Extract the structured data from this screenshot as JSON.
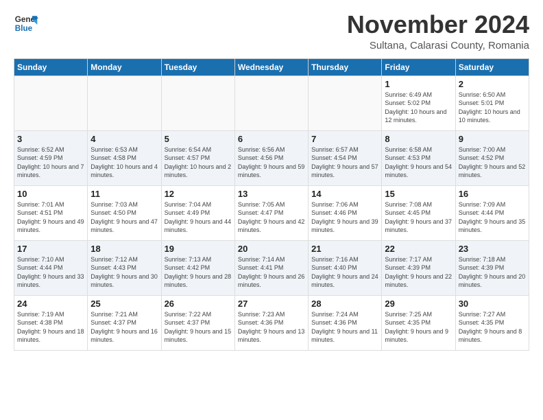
{
  "header": {
    "logo_line1": "General",
    "logo_line2": "Blue",
    "month_title": "November 2024",
    "location": "Sultana, Calarasi County, Romania"
  },
  "days_of_week": [
    "Sunday",
    "Monday",
    "Tuesday",
    "Wednesday",
    "Thursday",
    "Friday",
    "Saturday"
  ],
  "weeks": [
    [
      {
        "day": "",
        "info": ""
      },
      {
        "day": "",
        "info": ""
      },
      {
        "day": "",
        "info": ""
      },
      {
        "day": "",
        "info": ""
      },
      {
        "day": "",
        "info": ""
      },
      {
        "day": "1",
        "info": "Sunrise: 6:49 AM\nSunset: 5:02 PM\nDaylight: 10 hours and 12 minutes."
      },
      {
        "day": "2",
        "info": "Sunrise: 6:50 AM\nSunset: 5:01 PM\nDaylight: 10 hours and 10 minutes."
      }
    ],
    [
      {
        "day": "3",
        "info": "Sunrise: 6:52 AM\nSunset: 4:59 PM\nDaylight: 10 hours and 7 minutes."
      },
      {
        "day": "4",
        "info": "Sunrise: 6:53 AM\nSunset: 4:58 PM\nDaylight: 10 hours and 4 minutes."
      },
      {
        "day": "5",
        "info": "Sunrise: 6:54 AM\nSunset: 4:57 PM\nDaylight: 10 hours and 2 minutes."
      },
      {
        "day": "6",
        "info": "Sunrise: 6:56 AM\nSunset: 4:56 PM\nDaylight: 9 hours and 59 minutes."
      },
      {
        "day": "7",
        "info": "Sunrise: 6:57 AM\nSunset: 4:54 PM\nDaylight: 9 hours and 57 minutes."
      },
      {
        "day": "8",
        "info": "Sunrise: 6:58 AM\nSunset: 4:53 PM\nDaylight: 9 hours and 54 minutes."
      },
      {
        "day": "9",
        "info": "Sunrise: 7:00 AM\nSunset: 4:52 PM\nDaylight: 9 hours and 52 minutes."
      }
    ],
    [
      {
        "day": "10",
        "info": "Sunrise: 7:01 AM\nSunset: 4:51 PM\nDaylight: 9 hours and 49 minutes."
      },
      {
        "day": "11",
        "info": "Sunrise: 7:03 AM\nSunset: 4:50 PM\nDaylight: 9 hours and 47 minutes."
      },
      {
        "day": "12",
        "info": "Sunrise: 7:04 AM\nSunset: 4:49 PM\nDaylight: 9 hours and 44 minutes."
      },
      {
        "day": "13",
        "info": "Sunrise: 7:05 AM\nSunset: 4:47 PM\nDaylight: 9 hours and 42 minutes."
      },
      {
        "day": "14",
        "info": "Sunrise: 7:06 AM\nSunset: 4:46 PM\nDaylight: 9 hours and 39 minutes."
      },
      {
        "day": "15",
        "info": "Sunrise: 7:08 AM\nSunset: 4:45 PM\nDaylight: 9 hours and 37 minutes."
      },
      {
        "day": "16",
        "info": "Sunrise: 7:09 AM\nSunset: 4:44 PM\nDaylight: 9 hours and 35 minutes."
      }
    ],
    [
      {
        "day": "17",
        "info": "Sunrise: 7:10 AM\nSunset: 4:44 PM\nDaylight: 9 hours and 33 minutes."
      },
      {
        "day": "18",
        "info": "Sunrise: 7:12 AM\nSunset: 4:43 PM\nDaylight: 9 hours and 30 minutes."
      },
      {
        "day": "19",
        "info": "Sunrise: 7:13 AM\nSunset: 4:42 PM\nDaylight: 9 hours and 28 minutes."
      },
      {
        "day": "20",
        "info": "Sunrise: 7:14 AM\nSunset: 4:41 PM\nDaylight: 9 hours and 26 minutes."
      },
      {
        "day": "21",
        "info": "Sunrise: 7:16 AM\nSunset: 4:40 PM\nDaylight: 9 hours and 24 minutes."
      },
      {
        "day": "22",
        "info": "Sunrise: 7:17 AM\nSunset: 4:39 PM\nDaylight: 9 hours and 22 minutes."
      },
      {
        "day": "23",
        "info": "Sunrise: 7:18 AM\nSunset: 4:39 PM\nDaylight: 9 hours and 20 minutes."
      }
    ],
    [
      {
        "day": "24",
        "info": "Sunrise: 7:19 AM\nSunset: 4:38 PM\nDaylight: 9 hours and 18 minutes."
      },
      {
        "day": "25",
        "info": "Sunrise: 7:21 AM\nSunset: 4:37 PM\nDaylight: 9 hours and 16 minutes."
      },
      {
        "day": "26",
        "info": "Sunrise: 7:22 AM\nSunset: 4:37 PM\nDaylight: 9 hours and 15 minutes."
      },
      {
        "day": "27",
        "info": "Sunrise: 7:23 AM\nSunset: 4:36 PM\nDaylight: 9 hours and 13 minutes."
      },
      {
        "day": "28",
        "info": "Sunrise: 7:24 AM\nSunset: 4:36 PM\nDaylight: 9 hours and 11 minutes."
      },
      {
        "day": "29",
        "info": "Sunrise: 7:25 AM\nSunset: 4:35 PM\nDaylight: 9 hours and 9 minutes."
      },
      {
        "day": "30",
        "info": "Sunrise: 7:27 AM\nSunset: 4:35 PM\nDaylight: 9 hours and 8 minutes."
      }
    ]
  ]
}
